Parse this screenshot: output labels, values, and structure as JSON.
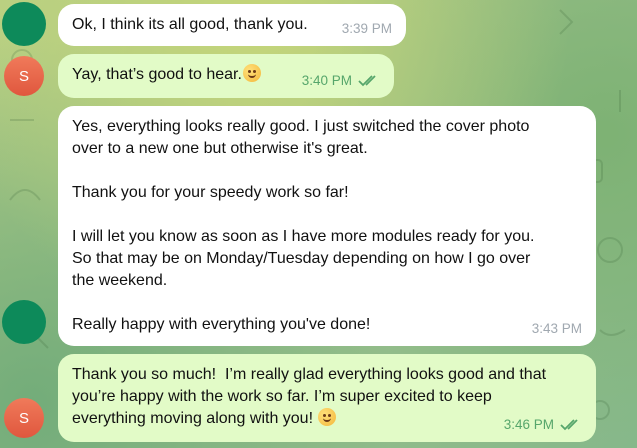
{
  "messages": [
    {
      "id": "m1",
      "text": "Ok, I think its all good, thank you.",
      "time": "3:39 PM",
      "direction": "in"
    },
    {
      "id": "m2",
      "text": "Yay, that’s good to hear.",
      "emoji": "smiling-face-emoji",
      "time": "3:40 PM",
      "direction": "out",
      "read": true
    },
    {
      "id": "m3",
      "text": "Yes, everything looks really good. I just switched the cover photo\nover to a new one but otherwise it's great.\n\nThank you for your speedy work so far!\n\nI will let you know as soon as I have more modules ready for you.\nSo that may be on Monday/Tuesday depending on how I go over\nthe weekend.\n\nReally happy with everything you've done!",
      "time": "3:43 PM",
      "direction": "in"
    },
    {
      "id": "m4",
      "text": "Thank you so much!  I’m really glad everything looks good and that\nyou’re happy with the work so far. I’m super excited to keep\neverything moving along with you! ",
      "emoji": "grinning-face-emoji",
      "time": "3:46 PM",
      "direction": "out",
      "read": true
    }
  ],
  "avatars": {
    "self_initial": "S"
  },
  "colors": {
    "incoming_bubble": "#ffffff",
    "outgoing_bubble": "#e2fbc7",
    "outgoing_time": "#56a66b",
    "avatar_contact": "#0d8a5a",
    "avatar_self": "#e0573e"
  }
}
